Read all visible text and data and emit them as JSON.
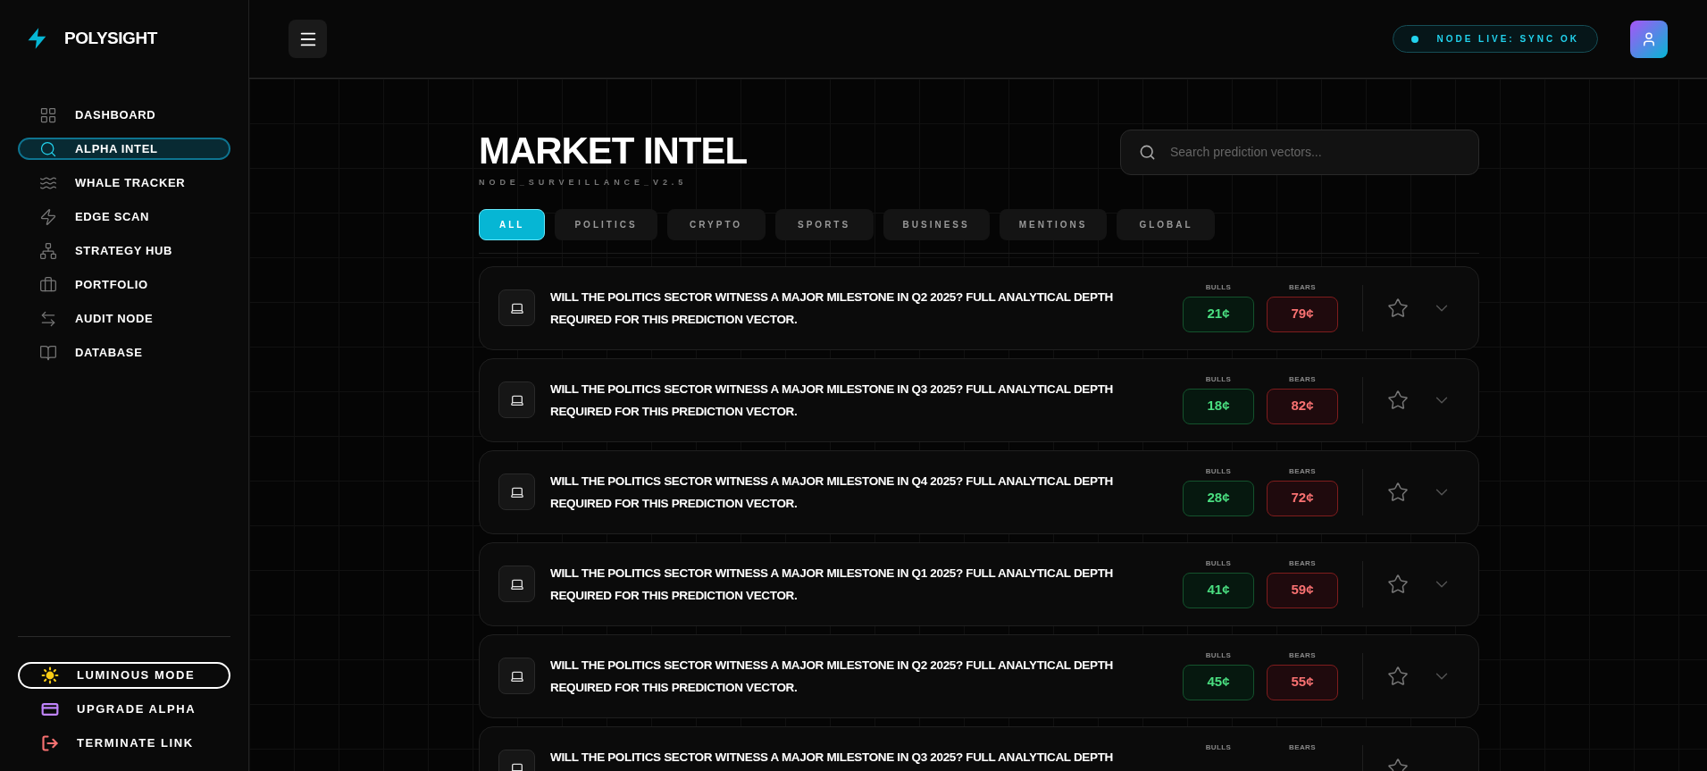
{
  "brand": {
    "name": "POLYSIGHT"
  },
  "sidebar": {
    "items": [
      {
        "label": "DASHBOARD",
        "kind": "grid",
        "selected": false
      },
      {
        "label": "ALPHA INTEL",
        "kind": "search",
        "selected": true
      },
      {
        "label": "WHALE TRACKER",
        "kind": "waves",
        "selected": false
      },
      {
        "label": "EDGE SCAN",
        "kind": "bolt",
        "selected": false
      },
      {
        "label": "STRATEGY HUB",
        "kind": "tree",
        "selected": false
      },
      {
        "label": "PORTFOLIO",
        "kind": "briefcase",
        "selected": false
      },
      {
        "label": "AUDIT NODE",
        "kind": "swap",
        "selected": false
      },
      {
        "label": "DATABASE",
        "kind": "book",
        "selected": false
      }
    ],
    "footer": [
      {
        "label": "LUMINOUS MODE",
        "kind": "sun",
        "color": "#facc15"
      },
      {
        "label": "UPGRADE ALPHA",
        "kind": "card",
        "color": "#c084fc"
      },
      {
        "label": "TERMINATE LINK",
        "kind": "logout",
        "color": "#f87171"
      }
    ]
  },
  "header": {
    "status": "NODE LIVE: SYNC OK"
  },
  "page": {
    "title": "MARKET INTEL",
    "subtitle": "NODE_SURVEILLANCE_V2.5",
    "search": {
      "placeholder": "Search prediction vectors..."
    }
  },
  "filters": [
    {
      "label": "ALL",
      "selected": true
    },
    {
      "label": "POLITICS",
      "selected": false
    },
    {
      "label": "CRYPTO",
      "selected": false
    },
    {
      "label": "SPORTS",
      "selected": false
    },
    {
      "label": "BUSINESS",
      "selected": false
    },
    {
      "label": "MENTIONS",
      "selected": false
    },
    {
      "label": "GLOBAL",
      "selected": false
    }
  ],
  "markets": [
    {
      "question": "WILL THE POLITICS SECTOR WITNESS A MAJOR MILESTONE IN Q2 2025? FULL ANALYTICAL DEPTH REQUIRED FOR THIS PREDICTION VECTOR.",
      "bulls_label": "BULLS",
      "bulls": "21¢",
      "bears_label": "BEARS",
      "bears": "79¢"
    },
    {
      "question": "WILL THE POLITICS SECTOR WITNESS A MAJOR MILESTONE IN Q3 2025? FULL ANALYTICAL DEPTH REQUIRED FOR THIS PREDICTION VECTOR.",
      "bulls_label": "BULLS",
      "bulls": "18¢",
      "bears_label": "BEARS",
      "bears": "82¢"
    },
    {
      "question": "WILL THE POLITICS SECTOR WITNESS A MAJOR MILESTONE IN Q4 2025? FULL ANALYTICAL DEPTH REQUIRED FOR THIS PREDICTION VECTOR.",
      "bulls_label": "BULLS",
      "bulls": "28¢",
      "bears_label": "BEARS",
      "bears": "72¢"
    },
    {
      "question": "WILL THE POLITICS SECTOR WITNESS A MAJOR MILESTONE IN Q1 2025? FULL ANALYTICAL DEPTH REQUIRED FOR THIS PREDICTION VECTOR.",
      "bulls_label": "BULLS",
      "bulls": "41¢",
      "bears_label": "BEARS",
      "bears": "59¢"
    },
    {
      "question": "WILL THE POLITICS SECTOR WITNESS A MAJOR MILESTONE IN Q2 2025? FULL ANALYTICAL DEPTH REQUIRED FOR THIS PREDICTION VECTOR.",
      "bulls_label": "BULLS",
      "bulls": "45¢",
      "bears_label": "BEARS",
      "bears": "55¢"
    },
    {
      "question": "WILL THE POLITICS SECTOR WITNESS A MAJOR MILESTONE IN Q3 2025? FULL ANALYTICAL DEPTH",
      "bulls_label": "BULLS",
      "bears_label": "BEARS"
    }
  ]
}
